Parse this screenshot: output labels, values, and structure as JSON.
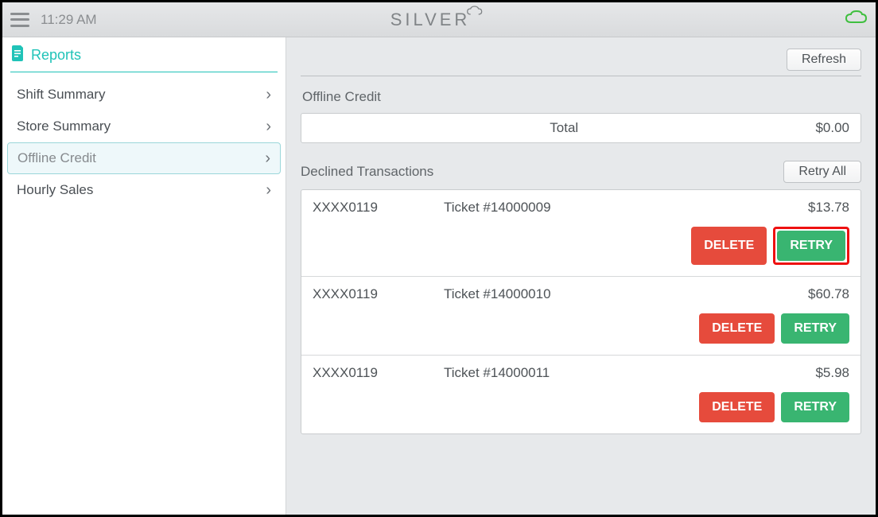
{
  "header": {
    "time": "11:29 AM",
    "logo_text": "SILVER"
  },
  "sidebar": {
    "title": "Reports",
    "items": [
      {
        "label": "Shift Summary"
      },
      {
        "label": "Store Summary"
      },
      {
        "label": "Offline Credit"
      },
      {
        "label": "Hourly Sales"
      }
    ]
  },
  "main": {
    "refresh_label": "Refresh",
    "offline_credit": {
      "title": "Offline Credit",
      "total_label": "Total",
      "total_value": "$0.00"
    },
    "declined": {
      "title": "Declined Transactions",
      "retry_all_label": "Retry All",
      "delete_label": "DELETE",
      "retry_label": "RETRY",
      "transactions": [
        {
          "card": "XXXX0119",
          "ticket": "Ticket #14000009",
          "amount": "$13.78"
        },
        {
          "card": "XXXX0119",
          "ticket": "Ticket #14000010",
          "amount": "$60.78"
        },
        {
          "card": "XXXX0119",
          "ticket": "Ticket #14000011",
          "amount": "$5.98"
        }
      ]
    }
  }
}
